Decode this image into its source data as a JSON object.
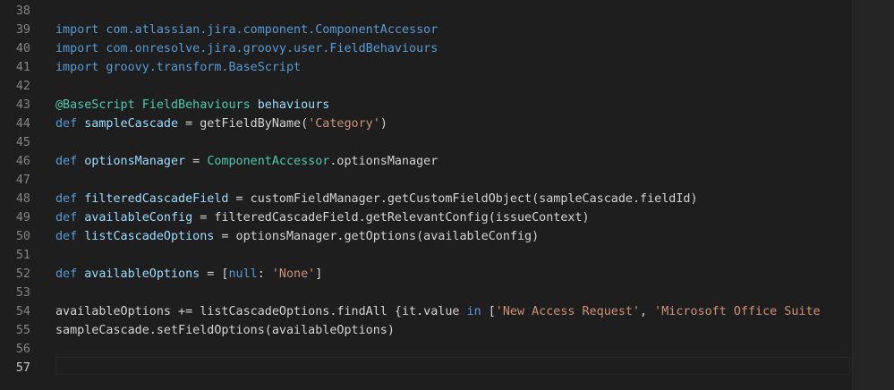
{
  "editor": {
    "active_line": "57",
    "lines": [
      {
        "num": "38",
        "tokens": []
      },
      {
        "num": "39",
        "tokens": [
          {
            "t": "import com.atlassian.jira.component.ComponentAccessor",
            "c": "kw"
          }
        ]
      },
      {
        "num": "40",
        "tokens": [
          {
            "t": "import com.onresolve.jira.groovy.user.FieldBehaviours",
            "c": "kw"
          }
        ]
      },
      {
        "num": "41",
        "tokens": [
          {
            "t": "import groovy.transform.BaseScript",
            "c": "kw"
          }
        ]
      },
      {
        "num": "42",
        "tokens": []
      },
      {
        "num": "43",
        "tokens": [
          {
            "t": "@BaseScript",
            "c": "type"
          },
          {
            "t": " ",
            "c": "plain"
          },
          {
            "t": "FieldBehaviours",
            "c": "type"
          },
          {
            "t": " ",
            "c": "plain"
          },
          {
            "t": "behaviours",
            "c": "var"
          }
        ]
      },
      {
        "num": "44",
        "tokens": [
          {
            "t": "def",
            "c": "kw"
          },
          {
            "t": " ",
            "c": "plain"
          },
          {
            "t": "sampleCascade",
            "c": "var"
          },
          {
            "t": " = getFieldByName(",
            "c": "plain"
          },
          {
            "t": "'Category'",
            "c": "str"
          },
          {
            "t": ")",
            "c": "plain"
          }
        ]
      },
      {
        "num": "45",
        "tokens": []
      },
      {
        "num": "46",
        "tokens": [
          {
            "t": "def",
            "c": "kw"
          },
          {
            "t": " ",
            "c": "plain"
          },
          {
            "t": "optionsManager",
            "c": "var"
          },
          {
            "t": " = ",
            "c": "plain"
          },
          {
            "t": "ComponentAccessor",
            "c": "type"
          },
          {
            "t": ".optionsManager",
            "c": "plain"
          }
        ]
      },
      {
        "num": "47",
        "tokens": []
      },
      {
        "num": "48",
        "tokens": [
          {
            "t": "def",
            "c": "kw"
          },
          {
            "t": " ",
            "c": "plain"
          },
          {
            "t": "filteredCascadeField",
            "c": "var"
          },
          {
            "t": " = customFieldManager.getCustomFieldObject(sampleCascade.fieldId)",
            "c": "plain"
          }
        ]
      },
      {
        "num": "49",
        "tokens": [
          {
            "t": "def",
            "c": "kw"
          },
          {
            "t": " ",
            "c": "plain"
          },
          {
            "t": "availableConfig",
            "c": "var"
          },
          {
            "t": " = filteredCascadeField.getRelevantConfig(issueContext)",
            "c": "plain"
          }
        ]
      },
      {
        "num": "50",
        "tokens": [
          {
            "t": "def",
            "c": "kw"
          },
          {
            "t": " ",
            "c": "plain"
          },
          {
            "t": "listCascadeOptions",
            "c": "var"
          },
          {
            "t": " = optionsManager.getOptions(availableConfig)",
            "c": "plain"
          }
        ]
      },
      {
        "num": "51",
        "tokens": []
      },
      {
        "num": "52",
        "tokens": [
          {
            "t": "def",
            "c": "kw"
          },
          {
            "t": " ",
            "c": "plain"
          },
          {
            "t": "availableOptions",
            "c": "var"
          },
          {
            "t": " = [",
            "c": "plain"
          },
          {
            "t": "null",
            "c": "kw"
          },
          {
            "t": ": ",
            "c": "plain"
          },
          {
            "t": "'None'",
            "c": "str"
          },
          {
            "t": "]",
            "c": "plain"
          }
        ]
      },
      {
        "num": "53",
        "tokens": []
      },
      {
        "num": "54",
        "tokens": [
          {
            "t": "availableOptions += listCascadeOptions.findAll {it.value ",
            "c": "plain"
          },
          {
            "t": "in",
            "c": "kw"
          },
          {
            "t": " [",
            "c": "plain"
          },
          {
            "t": "'New Access Request'",
            "c": "str"
          },
          {
            "t": ", ",
            "c": "plain"
          },
          {
            "t": "'Microsoft Office Suite",
            "c": "str"
          }
        ]
      },
      {
        "num": "55",
        "tokens": [
          {
            "t": "sampleCascade.setFieldOptions(availableOptions)",
            "c": "plain"
          }
        ]
      },
      {
        "num": "56",
        "tokens": []
      },
      {
        "num": "57",
        "tokens": []
      }
    ]
  }
}
